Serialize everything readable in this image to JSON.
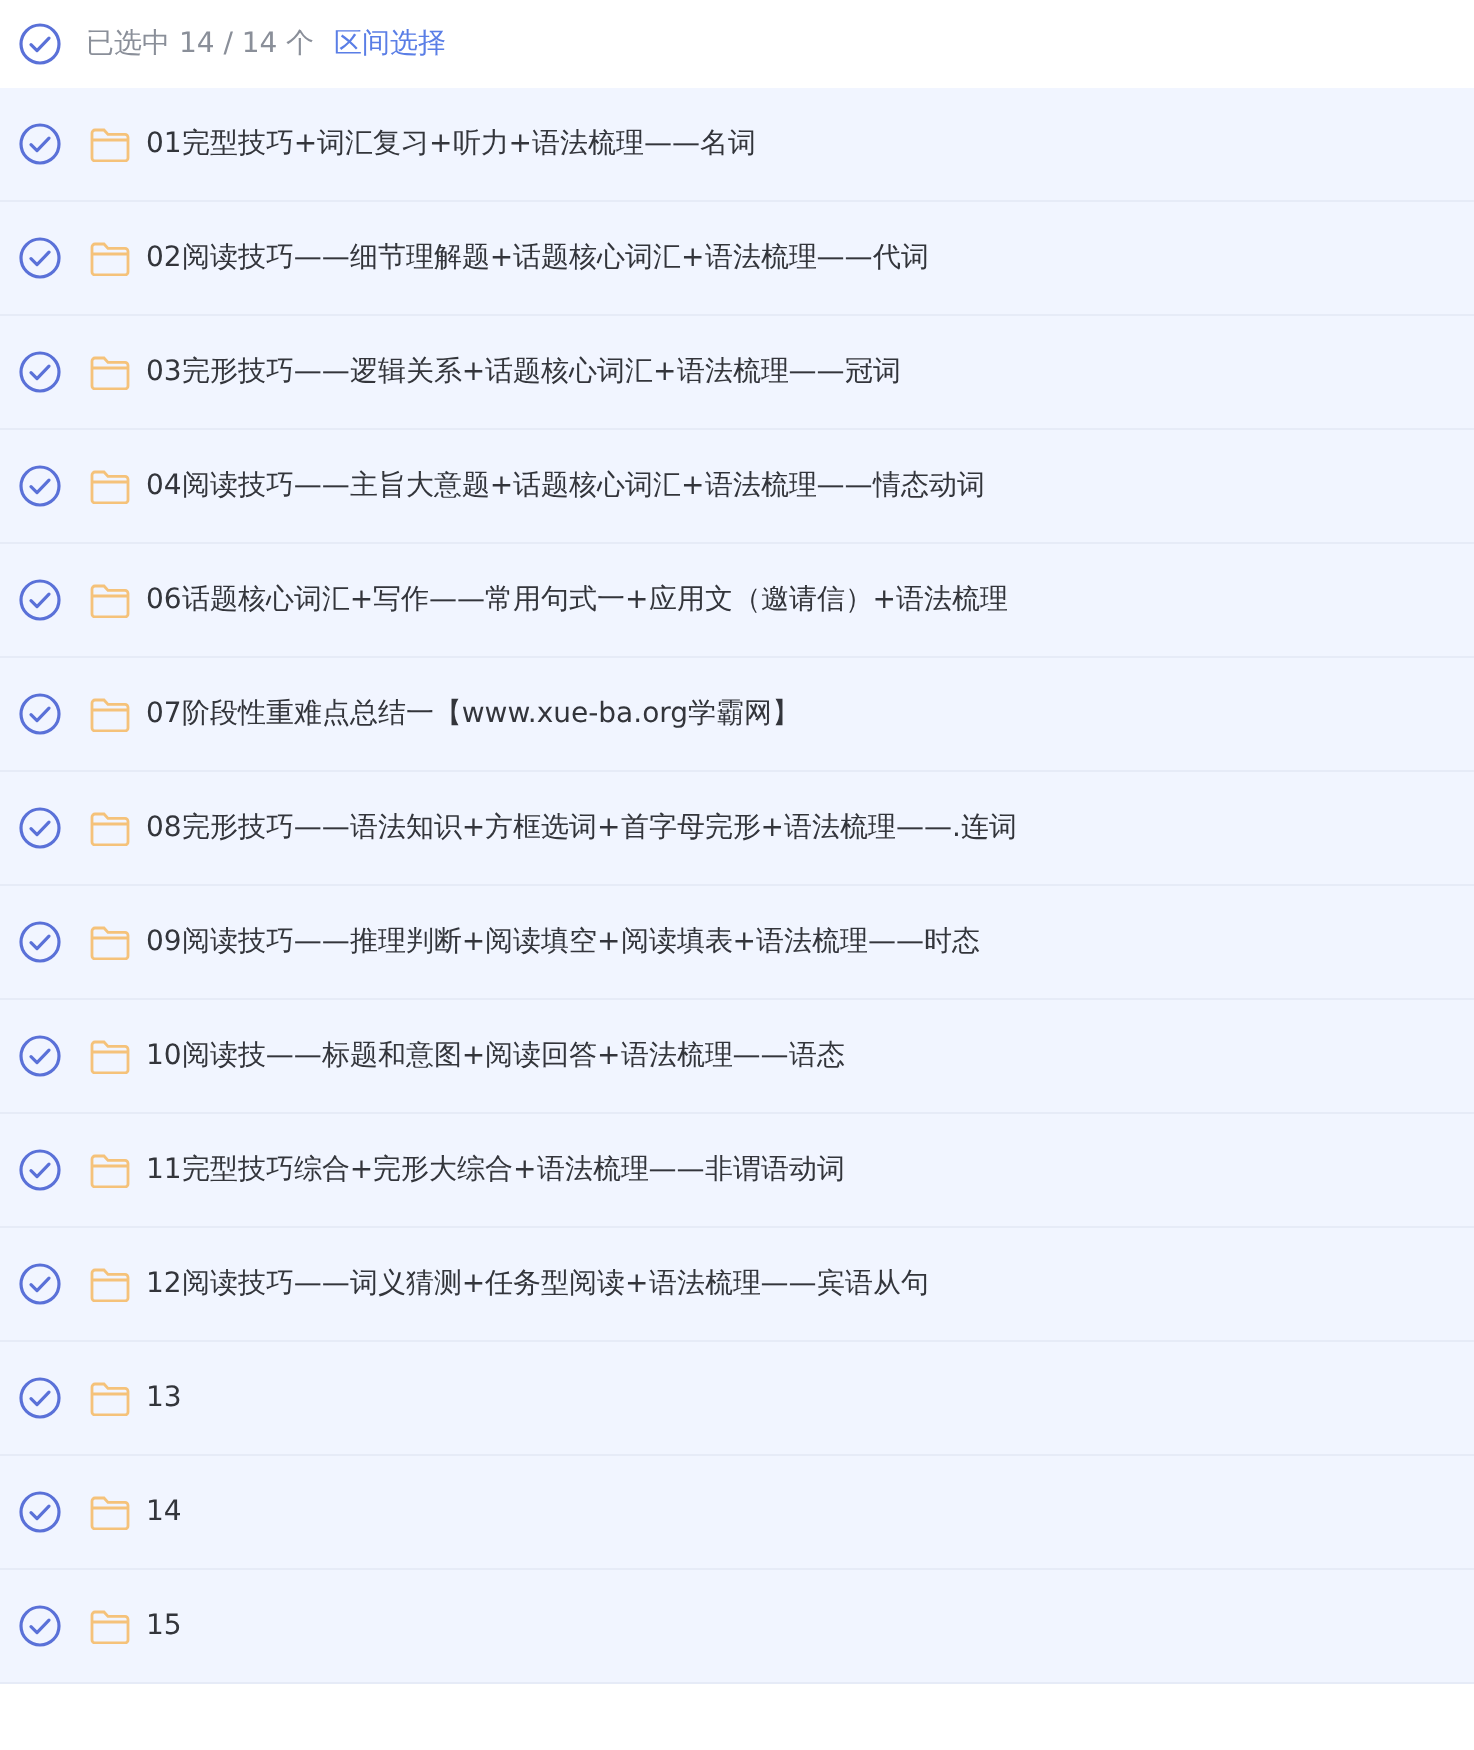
{
  "header": {
    "checked": true,
    "count": "已选中 14 / 14 个",
    "range_select": "区间选择"
  },
  "items": [
    {
      "name": "01完型技巧+词汇复习+听力+语法梳理——名词",
      "checked": true
    },
    {
      "name": "02阅读技巧——细节理解题+话题核心词汇+语法梳理——代词",
      "checked": true
    },
    {
      "name": "03完形技巧——逻辑关系+话题核心词汇+语法梳理——冠词",
      "checked": true
    },
    {
      "name": "04阅读技巧——主旨大意题+话题核心词汇+语法梳理——情态动词",
      "checked": true
    },
    {
      "name": "06话题核心词汇+写作——常用句式一+应用文（邀请信）+语法梳理",
      "checked": true
    },
    {
      "name": "07阶段性重难点总结一【www.xue-ba.org学霸网】",
      "checked": true
    },
    {
      "name": "08完形技巧——语法知识+方框选词+首字母完形+语法梳理——.连词",
      "checked": true
    },
    {
      "name": "09阅读技巧——推理判断+阅读填空+阅读填表+语法梳理——时态",
      "checked": true
    },
    {
      "name": "10阅读技——标题和意图+阅读回答+语法梳理——语态",
      "checked": true
    },
    {
      "name": "11完型技巧综合+完形大综合+语法梳理——非谓语动词",
      "checked": true
    },
    {
      "name": "12阅读技巧——词义猜测+任务型阅读+语法梳理——宾语从句",
      "checked": true
    },
    {
      "name": "13",
      "checked": true
    },
    {
      "name": "14",
      "checked": true
    },
    {
      "name": "15",
      "checked": true
    }
  ]
}
